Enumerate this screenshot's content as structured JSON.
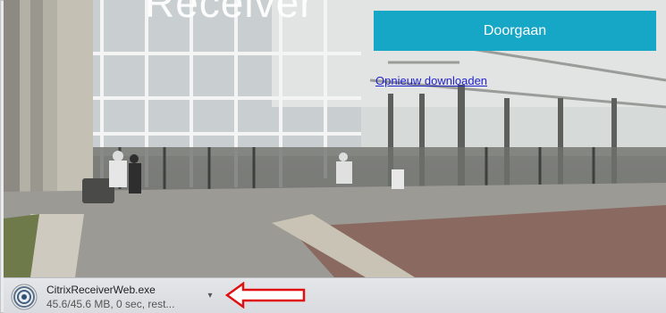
{
  "hero": {
    "word": "Receiver"
  },
  "continue_button": {
    "label": "Doorgaan"
  },
  "redownload_link": {
    "label": "Opnieuw downloaden"
  },
  "download": {
    "file_name": "CitrixReceiverWeb.exe",
    "status": "45.6/45.6 MB, 0 sec, rest...",
    "menu_icon": "chevron-down-icon",
    "file_icon": "citrix-receiver-icon"
  },
  "annotation": {
    "arrow_color": "#e01010",
    "arrow_icon": "left-arrow-icon"
  },
  "colors": {
    "accent": "#16a6c6",
    "link": "#2222cc"
  }
}
